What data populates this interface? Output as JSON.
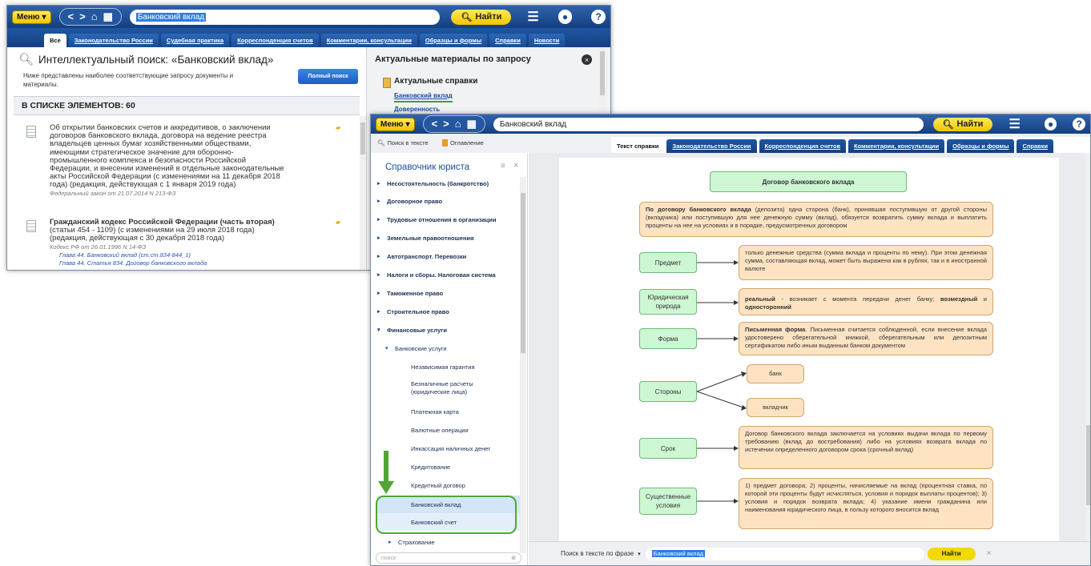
{
  "colors": {
    "toolbar_blue": "#1f57a3",
    "accent_yellow": "#f2c500",
    "node_green": "#cdf6d3",
    "node_orange": "#fde3c2",
    "highlight_green": "#4ea636"
  },
  "back_window": {
    "toolbar": {
      "menu_label": "Меню",
      "search_value": "Банковский вклад",
      "find_label": "Найти"
    },
    "tabs": [
      "Все",
      "Законодательство России",
      "Судебная практика",
      "Корреспонденция счетов",
      "Комментарии, консультации",
      "Образцы и формы",
      "Справки",
      "Новости"
    ],
    "search_title": "Интеллектуальный поиск: «Банковский вклад»",
    "search_hint": "Ниже представлены наиболее соответствующие запросу документы и материалы.",
    "full_search_button": "Полный поиск",
    "list_count": "В СПИСКЕ ЭЛЕМЕНТОВ: 60",
    "results": [
      {
        "lines": [
          "Об открытии банковских счетов и аккредитивов, о заключении",
          "договоров банковского вклада, договора на ведение реестра",
          "владельцев ценных бумаг хозяйственными обществами,",
          "имеющими стратегическое значение для оборонно-",
          "промышленного комплекса и безопасности Российской",
          "Федерации, и внесении изменений в отдельные законодательные",
          "акты Российской Федерации (с изменениями на 11 декабря 2018",
          "года) (редакция, действующая с 1 января 2019 года)"
        ],
        "meta": "Федеральный закон от 21.07.2014 N 213-ФЗ"
      },
      {
        "title": "Гражданский кодекс Российской Федерации (часть вторая)",
        "lines": [
          "(статьи 454 - 1109) (с изменениями на 29 июля 2018 года)",
          "(редакция, действующая с 30 декабря 2018 года)"
        ],
        "meta": "Кодекс РФ от 26.01.1996 N 14-ФЗ",
        "links": [
          "Глава 44. Банковский вклад (ст.ст.834-844_1)",
          "Глава 44. Статья 834. Договор банковского вклада"
        ]
      }
    ],
    "right_panel": {
      "title": "Актуальные материалы по запросу",
      "section": "Актуальные справки",
      "links": [
        "Банковский вклад",
        "Доверенность"
      ]
    }
  },
  "front_window": {
    "toolbar": {
      "menu_label": "Меню",
      "search_value": "Банковский вклад",
      "find_label": "Найти"
    },
    "side_links": {
      "search_in_text": "Поиск в тексте",
      "contents": "Оглавление"
    },
    "tabs": [
      "Текст справки",
      "Законодательство России",
      "Корреспонденция счетов",
      "Комментарии, консультации",
      "Образцы и формы",
      "Справки"
    ],
    "sidebar": {
      "title": "Справочник юриста",
      "items": [
        "Несостоятельность (банкротство)",
        "Договорное право",
        "Трудовые отношения в организации",
        "Земельные правоотношения",
        "Автотранспорт. Перевозки",
        "Налоги и сборы. Налоговая система",
        "Таможенное право",
        "Строительное право",
        "Финансовые услуги",
        "Банковские услуги",
        "Независимая гарантия",
        "Безналичные расчеты (юридические лица)",
        "Платежная карта",
        "Валютные операции",
        "Инкассация наличных денег",
        "Кредитование",
        "Кредитный договор",
        "Банковский вклад",
        "Банковский счет",
        "Страхование"
      ],
      "search_placeholder": "поиск"
    },
    "diagram": {
      "title": "Договор банковского вклада",
      "definition_bold": "По договору банковского вклада",
      "definition_rest": " (депозита) одна сторона (банк), принявшая поступившую от другой стороны (вкладчика) или поступившую для нее денежную сумму (вклад), обязуется возвратить сумму вклада и выплатить проценты на нее на условиях и в порядке, предусмотренных договором",
      "rows": [
        {
          "label": "Предмет",
          "text": "только денежные средства (сумма вклада и проценты по нему). При этом денежная сумма, составляющая вклад, может быть выражена как в рублях, так и в иностранной валюте"
        },
        {
          "label": "Юридическая природа",
          "b1": "реальный",
          "t1": " - возникает с момента передачи денег банку; ",
          "b2": "возмездный",
          "t2": " и ",
          "b3": "односторонний"
        },
        {
          "label": "Форма",
          "b1": "Письменная форма",
          "t1": ". Письменная считается соблюденной, если внесение вклада удостоверено сберегательной книжкой, сберегательным или депозитным сертификатом либо иным выданным банком документом"
        },
        {
          "label": "Стороны",
          "parties": [
            "банк",
            "вкладчик"
          ]
        },
        {
          "label": "Срок",
          "text": "Договор банковского вклада заключается на условиях выдачи вклада по первому требованию (вклад до востребования) либо на условиях возврата вклада по истечении определенного договором срока (срочный вклад)"
        },
        {
          "label": "Существенные условия",
          "text": "1) предмет договора; 2) проценты, начисляемые на вклад (процентная ставка, по которой эти проценты будут исчисляться, условия и порядок выплаты процентов); 3) условия и порядок возврата вклада; 4) указание имени гражданина или наименования юридического лица, в пользу которого вносится вклад"
        }
      ]
    },
    "bottom_bar": {
      "label": "Поиск в тексте по фразе",
      "search_value": "Банковский вклад",
      "find_label": "Найти"
    }
  }
}
